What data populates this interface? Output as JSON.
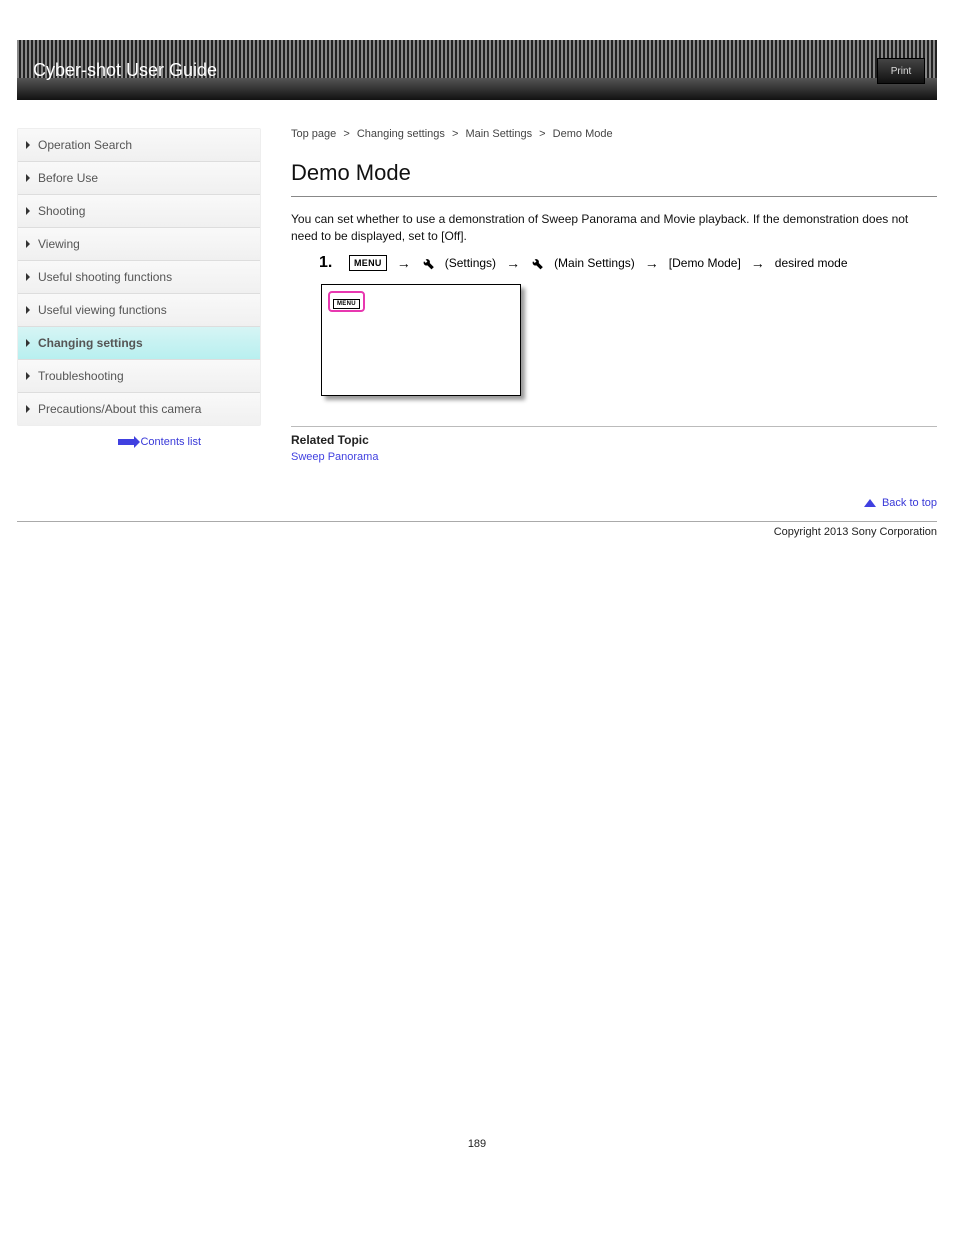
{
  "banner": {
    "title": "Cyber-shot User Guide",
    "print_label": "Print"
  },
  "breadcrumb": {
    "a": "Top page",
    "b": "Changing settings",
    "c": "Main Settings",
    "d": "Demo Mode",
    "sep": ">"
  },
  "sidebar": {
    "items": [
      {
        "label": "Operation Search"
      },
      {
        "label": "Before Use"
      },
      {
        "label": "Shooting"
      },
      {
        "label": "Viewing"
      },
      {
        "label": "Useful shooting functions"
      },
      {
        "label": "Useful viewing functions"
      },
      {
        "label": "Changing settings"
      },
      {
        "label": "Troubleshooting"
      },
      {
        "label": "Precautions/About this camera"
      }
    ],
    "back_label": "Contents list"
  },
  "heading": "Demo Mode",
  "description": "You can set whether to use a demonstration of Sweep Panorama and Movie playback. If the demonstration does not need to be displayed, set to [Off].",
  "step": {
    "num": "1.",
    "menu_label": "MENU",
    "settings": "(Settings)",
    "main_settings": "(Main Settings)",
    "target": "[Demo Mode]",
    "tail": "desired mode"
  },
  "related": {
    "title": "Related Topic",
    "link": "Sweep Panorama"
  },
  "to_top": "Back to top",
  "copyright": "Copyright 2013 Sony Corporation",
  "page_number": "189"
}
